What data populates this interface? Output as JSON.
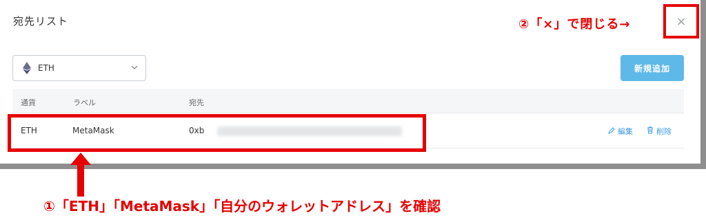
{
  "modal": {
    "title": "宛先リスト",
    "close_glyph": "×"
  },
  "currency_select": {
    "value": "ETH",
    "icon": "ethereum-icon"
  },
  "add_button_label": "新規追加",
  "table": {
    "headers": [
      "通貨",
      "ラベル",
      "宛先"
    ],
    "rows": [
      {
        "currency": "ETH",
        "label": "MetaMask",
        "address": "0xb",
        "edit_label": "編集",
        "delete_label": "削除"
      }
    ]
  },
  "annotations": {
    "close_note": "②「×」で閉じる→",
    "confirm_note": "①「ETH」「MetaMask」「自分のウォレットアドレス」を確認"
  },
  "colors": {
    "annotation_red": "#e60000",
    "primary_button": "#5fb9e8",
    "link_blue": "#3d9ae0"
  }
}
